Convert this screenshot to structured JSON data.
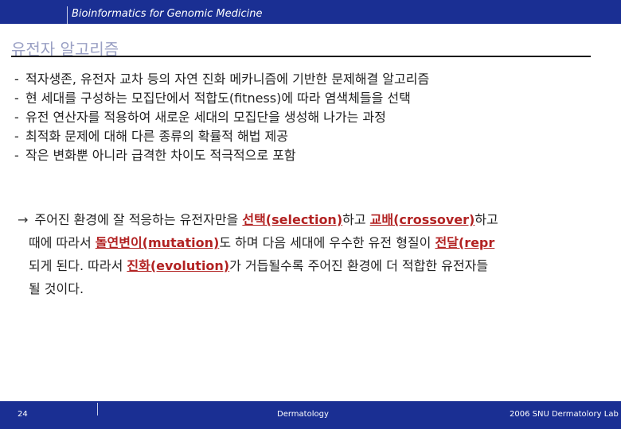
{
  "header": {
    "title": "Bioinformatics for Genomic Medicine"
  },
  "slide": {
    "title": "유전자 알고리즘"
  },
  "bullets": [
    "적자생존, 유전자 교차 등의 자연 진화 메카니즘에 기반한 문제해결 알고리즘",
    "현 세대를 구성하는 모집단에서 적합도(fitness)에 따라 염색체들을 선택",
    "유전 연산자를 적용하여 새로운 세대의 모집단을 생성해 나가는 과정",
    "최적화 문제에 대해 다른 종류의 확률적 해법 제공",
    "작은 변화뿐 아니라 급격한 차이도 적극적으로 포함"
  ],
  "bullet_marker": "-",
  "paragraph": {
    "arrow": "→",
    "l1_a": "주어진 환경에 잘 적응하는 유전자만을 ",
    "l1_sel": "선택(selection)",
    "l1_b": "하고 ",
    "l1_cross": "교배(crossover)",
    "l1_c": "하고",
    "l2_a": "때에 따라서 ",
    "l2_mut": "돌연변이(mutation)",
    "l2_b": "도 하며 다음 세대에 우수한 유전 형질이 ",
    "l2_rep": "전달(repr",
    "l3_a": "되게 된다. 따라서 ",
    "l3_evo": "진화(evolution)",
    "l3_b": "가 거듭될수록 주어진 환경에 더 적합한 유전자들",
    "l4": "될 것이다."
  },
  "footer": {
    "page_number": "24",
    "department": "Dermatology",
    "lab": "2006 SNU Dermatolory Lab"
  },
  "colors": {
    "bar": "#1a2f93",
    "highlight": "#b22222",
    "title": "#9aa0c4"
  }
}
